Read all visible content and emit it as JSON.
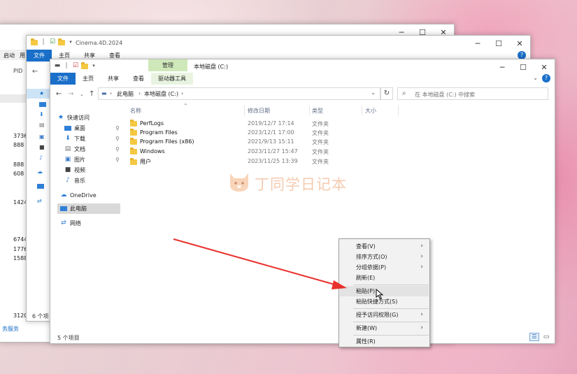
{
  "back_window": {
    "toolbar_left": "启动",
    "toolbar_left2": "用",
    "pid_header": "PID",
    "pids": [
      "3736",
      "888",
      "888",
      "608",
      "1424",
      "6744",
      "1776",
      "1588",
      "3120"
    ],
    "status": "务服务"
  },
  "mid_window": {
    "title": "Cinema.4D.2024",
    "tabs": [
      "文件",
      "主页",
      "共享",
      "查看"
    ],
    "status": "6 个项"
  },
  "explorer": {
    "tools_tab": "管理",
    "tools_sub": "驱动器工具",
    "title": "本地磁盘 (C:)",
    "tabs": [
      "文件",
      "主页",
      "共享",
      "查看"
    ],
    "breadcrumb": {
      "root": "此电脑",
      "sep": "›",
      "current": "本地磁盘 (C:)"
    },
    "search_placeholder": "在 本地磁盘 (C:) 中搜索",
    "sidebar": {
      "quick_access": "快速访问",
      "items": [
        "桌面",
        "下载",
        "文档",
        "图片",
        "视频",
        "音乐"
      ],
      "onedrive": "OneDrive",
      "this_pc": "此电脑",
      "network": "网络"
    },
    "columns": {
      "name": "名称",
      "date": "修改日期",
      "type": "类型",
      "size": "大小"
    },
    "files": [
      {
        "name": "PerfLogs",
        "date": "2019/12/7 17:14",
        "type": "文件夹"
      },
      {
        "name": "Program Files",
        "date": "2023/12/1 17:00",
        "type": "文件夹"
      },
      {
        "name": "Program Files (x86)",
        "date": "2021/9/13 15:11",
        "type": "文件夹"
      },
      {
        "name": "Windows",
        "date": "2023/11/27 15:47",
        "type": "文件夹"
      },
      {
        "name": "用户",
        "date": "2023/11/25 13:39",
        "type": "文件夹"
      }
    ],
    "status": "5 个项目"
  },
  "watermark": "丁同学日记本",
  "context_menu": {
    "view": "查看(V)",
    "sort": "排序方式(O)",
    "group": "分组依据(P)",
    "refresh": "刷新(E)",
    "paste": "粘贴(P)",
    "paste_shortcut": "粘贴快捷方式(S)",
    "grant_access": "授予访问权限(G)",
    "new": "新建(W)",
    "properties": "属性(R)",
    "arrow": "›"
  },
  "colors": {
    "accent": "#1a6fc9",
    "tools_tab": "#cfe8b9",
    "arrow": "#e8312d"
  }
}
